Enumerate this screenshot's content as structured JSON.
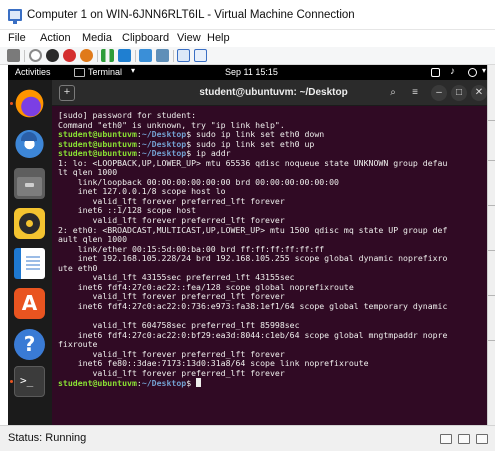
{
  "vm_window": {
    "title": "Computer 1 on WIN-6JNN6RLT6IL - Virtual Machine Connection",
    "menu": [
      "File",
      "Action",
      "Media",
      "Clipboard",
      "View",
      "Help"
    ],
    "status": "Status: Running"
  },
  "toolbar_icons": [
    "ctrl-alt-del-icon",
    "start-icon",
    "turn-off-icon",
    "shutdown-icon",
    "save-icon",
    "pause-icon",
    "reset-icon",
    "checkpoint-icon",
    "revert-icon",
    "enhanced-session-icon",
    "share-icon"
  ],
  "gnome_top_bar": {
    "activities": "Activities",
    "app_name": "Terminal",
    "app_menu_chevron": "▾",
    "clock": "Sep 11  15:15",
    "system_menu_chevron": "▾"
  },
  "dock_items": [
    "Firefox",
    "Thunderbird",
    "Files",
    "Rhythmbox",
    "LibreOffice Writer",
    "Ubuntu Software",
    "Help",
    "Terminal"
  ],
  "dock_glyphs": {
    "software": "A",
    "help": "?"
  },
  "terminal": {
    "title": "student@ubuntuvm: ~/Desktop",
    "new_tab_glyph": "+",
    "search_glyph": "⌕",
    "menu_glyph": "≡",
    "minimize_glyph": "–",
    "maximize_glyph": "□",
    "close_glyph": "✕",
    "prompt_user": "student@ubuntuvm",
    "prompt_path": "~/Desktop",
    "lines": [
      {
        "type": "out",
        "text": "[sudo] password for student:"
      },
      {
        "type": "out",
        "text": "Command \"eth0\" is unknown, try \"ip link help\"."
      },
      {
        "type": "cmd",
        "cmd": " sudo ip link set eth0 down"
      },
      {
        "type": "cmd",
        "cmd": " sudo ip link set eth0 up"
      },
      {
        "type": "cmd",
        "cmd": " ip addr"
      },
      {
        "type": "out",
        "text": "1: lo: <LOOPBACK,UP,LOWER_UP> mtu 65536 qdisc noqueue state UNKNOWN group defau"
      },
      {
        "type": "out",
        "text": "lt qlen 1000"
      },
      {
        "type": "out",
        "text": "    link/loopback 00:00:00:00:00:00 brd 00:00:00:00:00:00"
      },
      {
        "type": "out",
        "text": "    inet 127.0.0.1/8 scope host lo"
      },
      {
        "type": "out",
        "text": "       valid_lft forever preferred_lft forever"
      },
      {
        "type": "out",
        "text": "    inet6 ::1/128 scope host"
      },
      {
        "type": "out",
        "text": "       valid_lft forever preferred_lft forever"
      },
      {
        "type": "out",
        "text": "2: eth0: <BROADCAST,MULTICAST,UP,LOWER_UP> mtu 1500 qdisc mq state UP group def"
      },
      {
        "type": "out",
        "text": "ault qlen 1000"
      },
      {
        "type": "out",
        "text": "    link/ether 00:15:5d:00:ba:00 brd ff:ff:ff:ff:ff:ff"
      },
      {
        "type": "out",
        "text": "    inet 192.168.105.228/24 brd 192.168.105.255 scope global dynamic noprefixro"
      },
      {
        "type": "out",
        "text": "ute eth0"
      },
      {
        "type": "out",
        "text": "       valid_lft 43155sec preferred_lft 43155sec"
      },
      {
        "type": "out",
        "text": "    inet6 fdf4:27c0:ac22::fea/128 scope global noprefixroute"
      },
      {
        "type": "out",
        "text": "       valid_lft forever preferred_lft forever"
      },
      {
        "type": "out",
        "text": "    inet6 fdf4:27c0:ac22:0:736:e973:fa38:1ef1/64 scope global temporary dynamic"
      },
      {
        "type": "out",
        "text": ""
      },
      {
        "type": "out",
        "text": "       valid_lft 604758sec preferred_lft 85998sec"
      },
      {
        "type": "out",
        "text": "    inet6 fdf4:27c0:ac22:0:bf29:ea3d:8044:c1eb/64 scope global mngtmpaddr nopre"
      },
      {
        "type": "out",
        "text": "fixroute"
      },
      {
        "type": "out",
        "text": "       valid_lft forever preferred_lft forever"
      },
      {
        "type": "out",
        "text": "    inet6 fe80::3dae:7173:13d0:31a8/64 scope link noprefixroute"
      },
      {
        "type": "out",
        "text": "       valid_lft forever preferred_lft forever"
      },
      {
        "type": "cursor",
        "cmd": " "
      }
    ]
  },
  "colors": {
    "terminal_bg": "#300a24",
    "prompt_user": "#8ae234",
    "prompt_path": "#729fcf",
    "terminal_fg": "#eeeeec",
    "dock_bg": "#1b1b1b"
  }
}
